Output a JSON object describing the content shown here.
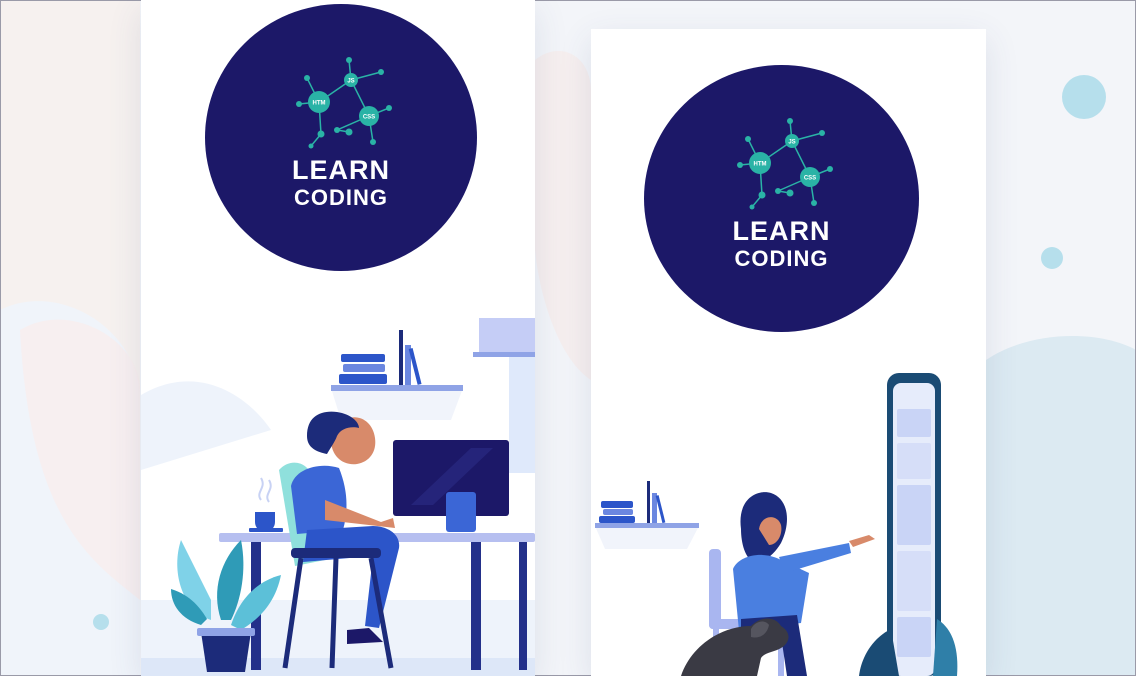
{
  "screens": [
    {
      "logo": {
        "line1": "LEARN",
        "line2": "CODING"
      },
      "nodes": [
        "HTM",
        "JS",
        "CSS"
      ]
    },
    {
      "logo": {
        "line1": "LEARN",
        "line2": "CODING"
      },
      "nodes": [
        "HTM",
        "JS",
        "CSS"
      ]
    }
  ],
  "colors": {
    "brand_navy": "#1c1868",
    "accent_teal": "#2ab3a6",
    "illustration_blue": "#2c55c9",
    "background": "#f3f5f9"
  }
}
